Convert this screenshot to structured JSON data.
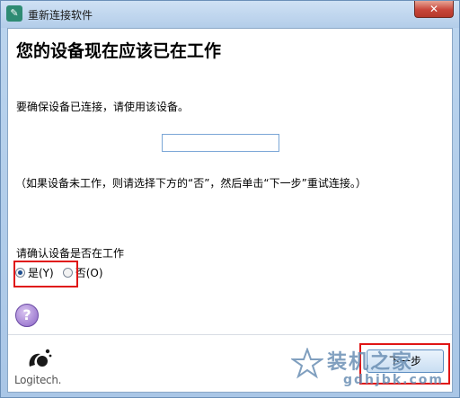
{
  "window": {
    "title": "重新连接软件",
    "close_label": "✕"
  },
  "content": {
    "heading": "您的设备现在应该已在工作",
    "instruction": "要确保设备已连接，请使用该设备。",
    "input_value": "",
    "hint": "（如果设备未工作，则请选择下方的“否”，然后单击“下一步”重试连接。）",
    "question": "请确认设备是否在工作",
    "radios": [
      {
        "label": "是(Y)",
        "checked": true
      },
      {
        "label": "否(O)",
        "checked": false
      }
    ],
    "help_label": "?"
  },
  "footer": {
    "logo_text": "Logitech.",
    "next_label": "下一步"
  },
  "watermark": {
    "title": "装机之家",
    "url": "gdhjbk.com"
  },
  "colors": {
    "highlight_red": "#e01515",
    "title_bar": "#b3cde9",
    "close_red": "#c8463a"
  }
}
